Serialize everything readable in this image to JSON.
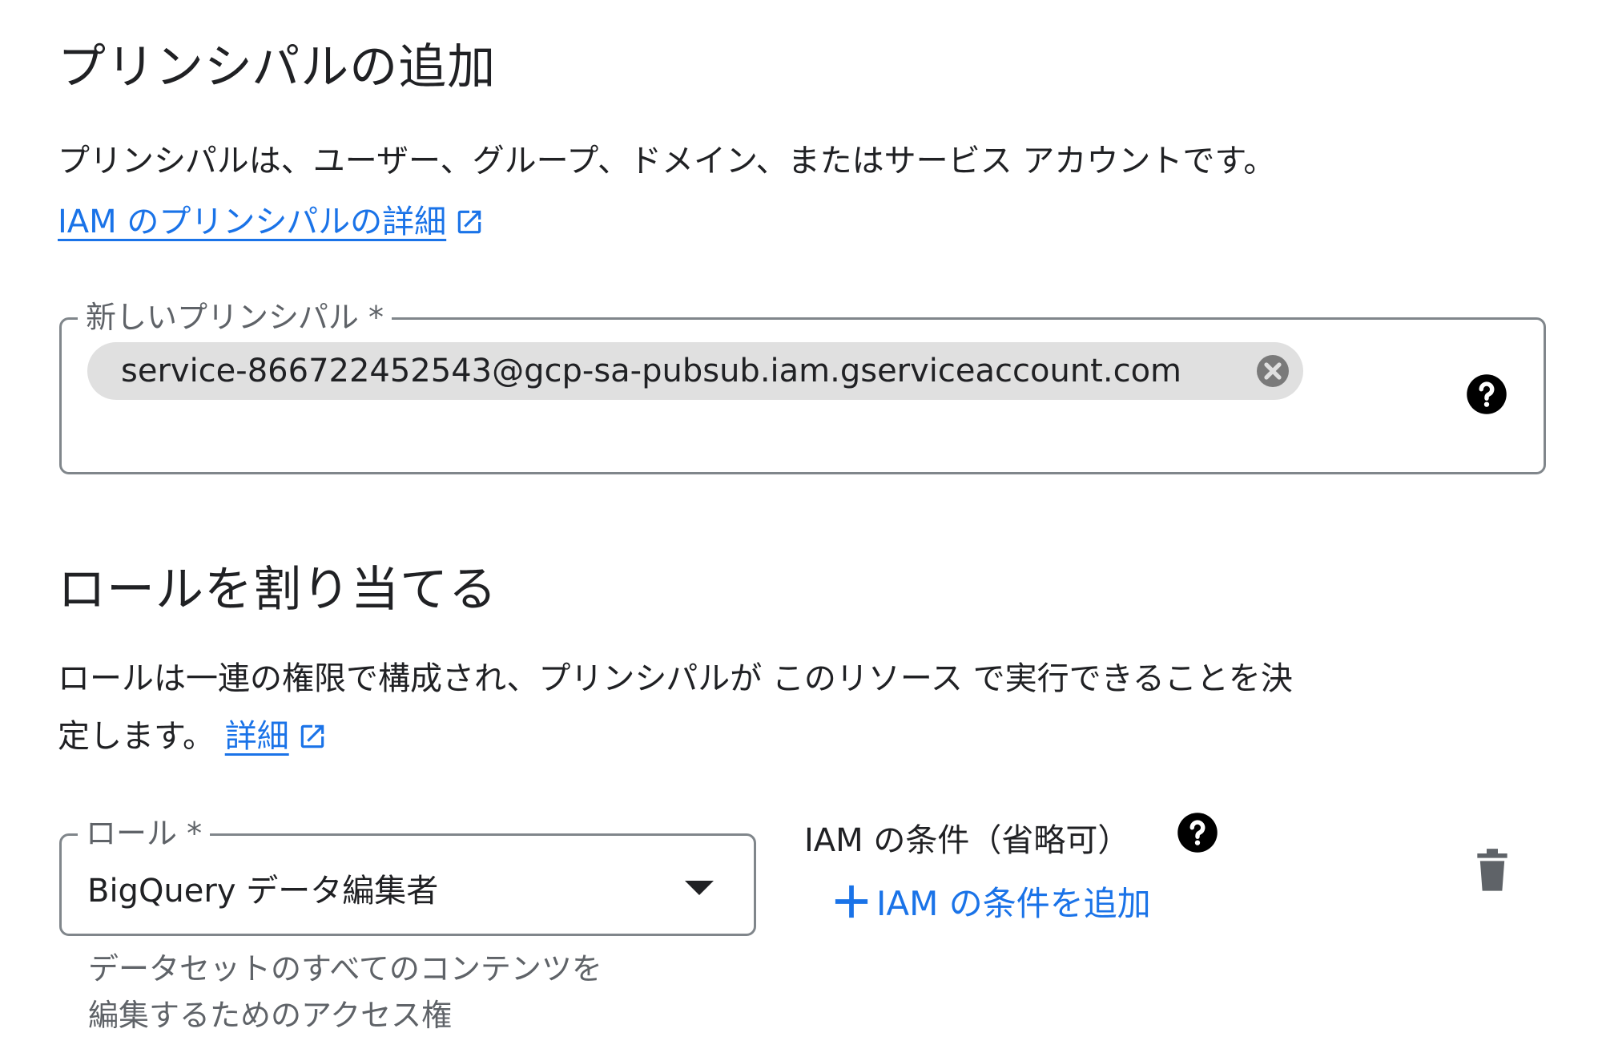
{
  "principals": {
    "title": "プリンシパルの追加",
    "description": "プリンシパルは、ユーザー、グループ、ドメイン、またはサービス アカウントです。",
    "learn_more_link": "IAM のプリンシパルの詳細",
    "new_principal_label": "新しいプリンシパル *",
    "chip_value": "service-866722452543@gcp-sa-pubsub.iam.gserviceaccount.com"
  },
  "roles": {
    "title": "ロールを割り当てる",
    "description_line1": "ロールは一連の権限で構成され、プリンシパルが このリソース で実行できることを決",
    "description_line2": "定します。",
    "details_link": "詳細",
    "role_label": "ロール *",
    "role_value": "BigQuery データ編集者",
    "role_hint_line1": "データセットのすべてのコンテンツを",
    "role_hint_line2": "編集するためのアクセス権",
    "condition_label": "IAM の条件（省略可）",
    "add_condition_button": "IAM の条件を追加"
  },
  "colors": {
    "link": "#1a73e8",
    "chip_background": "#e0e0e0",
    "field_border": "#80868b"
  },
  "icons": [
    "external-link-icon",
    "chip-remove-icon",
    "help-icon",
    "dropdown-caret-icon",
    "plus-icon",
    "trash-icon"
  ]
}
